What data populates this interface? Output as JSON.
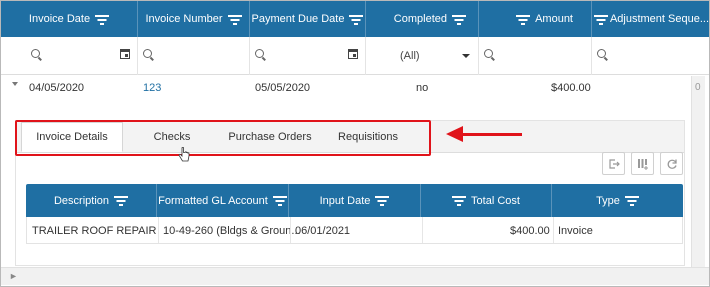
{
  "grid": {
    "columns": [
      {
        "label": "Invoice Date"
      },
      {
        "label": "Invoice Number"
      },
      {
        "label": "Payment Due Date"
      },
      {
        "label": "Completed"
      },
      {
        "label": "Amount"
      },
      {
        "label": "Adjustment Seque..."
      }
    ],
    "filter": {
      "completed_value": "(All)"
    },
    "row": {
      "invoice_date": "04/05/2020",
      "invoice_number": "123",
      "payment_due_date": "05/05/2020",
      "completed": "no",
      "amount": "$400.00",
      "adjustment_seq": "0"
    }
  },
  "detail": {
    "tabs": [
      {
        "label": "Invoice Details"
      },
      {
        "label": "Checks"
      },
      {
        "label": "Purchase Orders"
      },
      {
        "label": "Requisitions"
      }
    ],
    "toolbar": {
      "export_icon": "export-icon",
      "columns_icon": "column-chooser-icon",
      "refresh_icon": "refresh-icon"
    },
    "columns": [
      {
        "label": "Description"
      },
      {
        "label": "Formatted GL Account"
      },
      {
        "label": "Input Date"
      },
      {
        "label": "Total Cost"
      },
      {
        "label": "Type"
      }
    ],
    "row": {
      "description": "TRAILER ROOF REPAIR",
      "gl_account": "10-49-260 (Bldgs & Groun...",
      "input_date": "06/01/2021",
      "total_cost": "$400.00",
      "type": "Invoice"
    }
  },
  "colors": {
    "header_bg": "#1f6fa3",
    "highlight": "#e0131a",
    "link": "#1f6fa3"
  }
}
